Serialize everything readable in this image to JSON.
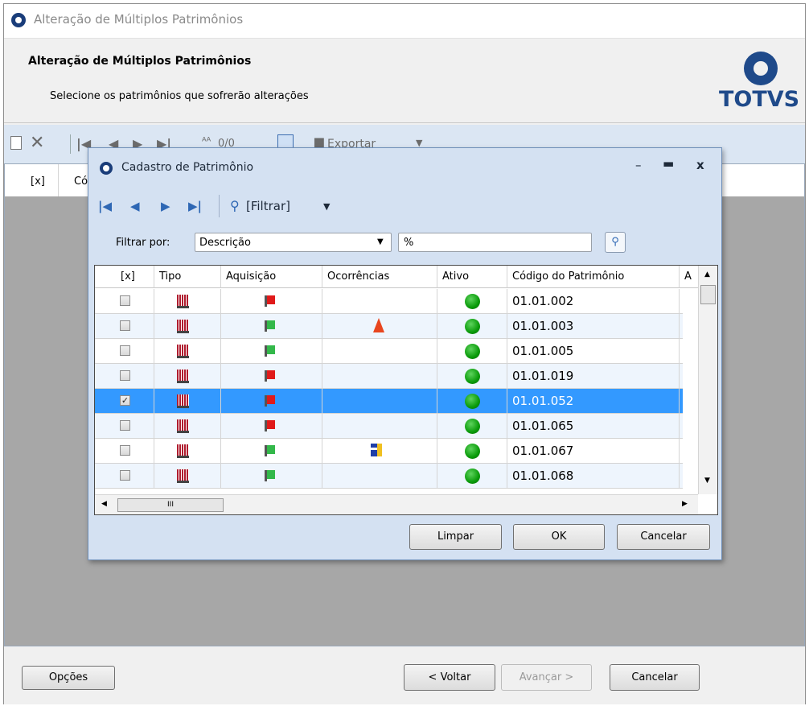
{
  "window": {
    "title": "Alteração de Múltiplos Patrimônios"
  },
  "header": {
    "title": "Alteração de Múltiplos Patrimônios",
    "subtitle": "Selecione os patrimônios que sofrerão alterações",
    "logo_text": "TOTVS"
  },
  "toolbar": {
    "counter": "0/0",
    "export_label": "Exportar"
  },
  "grid": {
    "col_x": "[x]",
    "col_code_partial": "Có"
  },
  "dialog": {
    "title": "Cadastro de Patrimônio",
    "filter_button": "[Filtrar]",
    "filter_by_label": "Filtrar por:",
    "filter_field": "Descrição",
    "filter_value": "%",
    "columns": [
      "[x]",
      "Tipo",
      "Aquisição",
      "Ocorrências",
      "Ativo",
      "Código do Patrimônio",
      "A"
    ],
    "rows": [
      {
        "checked": false,
        "acq": "red",
        "occ": "",
        "active": true,
        "code": "01.01.002"
      },
      {
        "checked": false,
        "acq": "green",
        "occ": "cone",
        "active": true,
        "code": "01.01.003"
      },
      {
        "checked": false,
        "acq": "green",
        "occ": "",
        "active": true,
        "code": "01.01.005"
      },
      {
        "checked": false,
        "acq": "red",
        "occ": "",
        "active": true,
        "code": "01.01.019"
      },
      {
        "checked": true,
        "acq": "red",
        "occ": "",
        "active": true,
        "code": "01.01.052"
      },
      {
        "checked": false,
        "acq": "red",
        "occ": "",
        "active": true,
        "code": "01.01.065"
      },
      {
        "checked": false,
        "acq": "green",
        "occ": "lighthouse",
        "active": true,
        "code": "01.01.067"
      },
      {
        "checked": false,
        "acq": "green",
        "occ": "",
        "active": true,
        "code": "01.01.068"
      }
    ],
    "selected_row": 4,
    "hscroll_label": "III",
    "buttons": {
      "clear": "Limpar",
      "ok": "OK",
      "cancel": "Cancelar"
    }
  },
  "footer": {
    "options": "Opções",
    "back": "< Voltar",
    "next": "Avançar >",
    "cancel": "Cancelar"
  },
  "colors": {
    "selection": "#3399ff",
    "brand": "#1f4a8a",
    "flag_red": "#e01a1a",
    "flag_green": "#33b84a",
    "active_green": "#0a9b0a"
  }
}
